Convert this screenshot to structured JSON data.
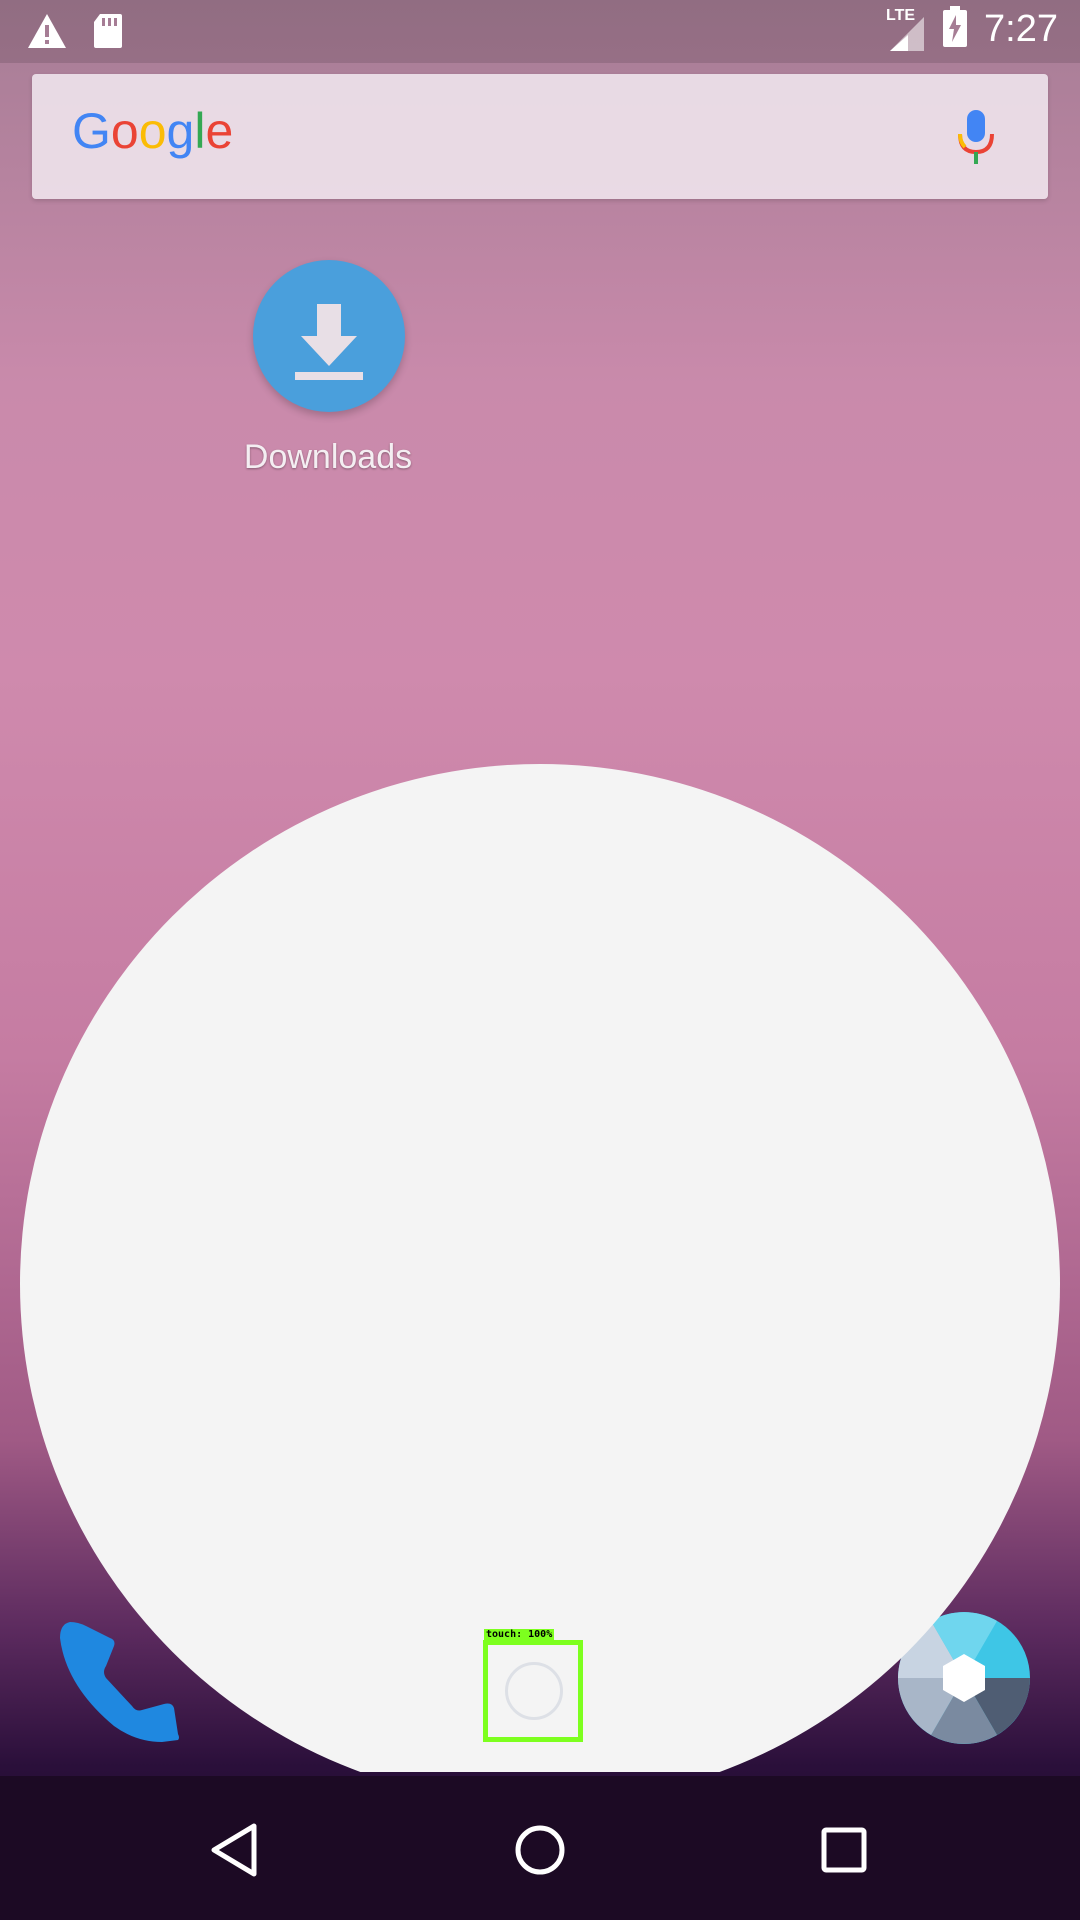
{
  "status_bar": {
    "time": "7:27",
    "network": "LTE",
    "icons": [
      "warning-icon",
      "sd-card-icon",
      "signal-icon",
      "battery-charging-icon"
    ]
  },
  "search": {
    "logo_text": "Google",
    "logo_colors": [
      "#4285F4",
      "#EA4335",
      "#FBBC05",
      "#4285F4",
      "#34A853",
      "#EA4335"
    ],
    "mic_icon": "mic-icon"
  },
  "home": {
    "apps": [
      {
        "label": "Downloads",
        "icon": "download-icon",
        "color": "#4a9fdc"
      }
    ],
    "dock": [
      {
        "icon": "phone-icon",
        "color": "#1f88e0"
      },
      {
        "icon": "app-drawer-icon"
      },
      {
        "icon": "camera-icon",
        "color": "#3ec6e6"
      }
    ]
  },
  "touch_overlay": {
    "label": "touch: 100%",
    "color": "#7dff1e"
  },
  "nav": {
    "buttons": [
      "back-icon",
      "home-icon",
      "recents-icon"
    ]
  }
}
